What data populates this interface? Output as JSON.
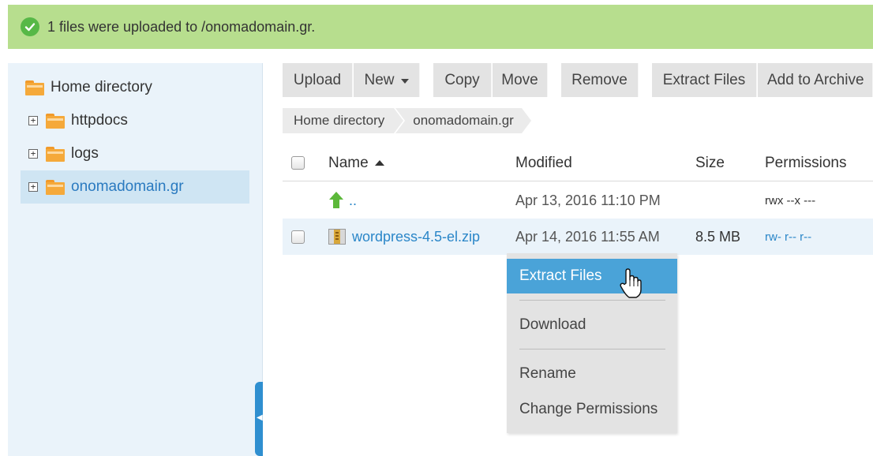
{
  "notification": {
    "message": "1 files were uploaded to /onomadomain.gr.",
    "icon": "check-circle-icon",
    "color": "#b7de8e"
  },
  "sidebar": {
    "items": [
      {
        "label": "Home directory",
        "icon": "folder-icon",
        "expander": ""
      },
      {
        "label": "httpdocs",
        "icon": "folder-icon",
        "expander": "+"
      },
      {
        "label": "logs",
        "icon": "folder-icon",
        "expander": "+"
      },
      {
        "label": "onomadomain.gr",
        "icon": "folder-icon",
        "expander": "+",
        "selected": true
      }
    ]
  },
  "toolbar": {
    "upload": "Upload",
    "new": "New",
    "copy": "Copy",
    "move": "Move",
    "remove": "Remove",
    "extract_files": "Extract Files",
    "add_to_archive": "Add to Archive"
  },
  "breadcrumb": [
    "Home directory",
    "onomadomain.gr"
  ],
  "table": {
    "columns": {
      "name": "Name",
      "modified": "Modified",
      "size": "Size",
      "permissions": "Permissions"
    },
    "rows": [
      {
        "name": "..",
        "modified": "Apr 13, 2016 11:10 PM",
        "size": "",
        "permissions": "rwx --x ---",
        "icon": "up-arrow-icon"
      },
      {
        "name": "wordpress-4.5-el.zip",
        "modified": "Apr 14, 2016 11:55 AM",
        "size": "8.5 MB",
        "permissions": "rw- r-- r--",
        "icon": "zip-archive-icon"
      }
    ]
  },
  "context_menu": {
    "items": [
      "Extract Files",
      "Download",
      "Rename",
      "Change Permissions"
    ],
    "active_index": 0
  },
  "colors": {
    "accent": "#2a86c8",
    "menu_active": "#4aa3d8",
    "folder": "#f5a93a",
    "sidebar_bg": "#eaf3fa"
  }
}
